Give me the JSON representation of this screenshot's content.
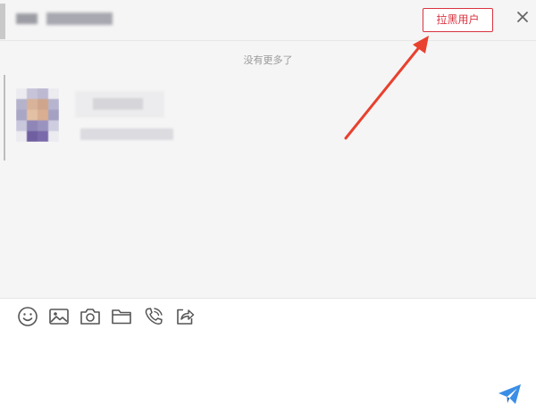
{
  "header": {
    "block_user_label": "拉黑用户",
    "close_icon": "close-icon"
  },
  "messages": {
    "no_more_text": "没有更多了"
  },
  "toolbar": {
    "icons": [
      "emoji-icon",
      "image-icon",
      "camera-icon",
      "folder-icon",
      "phone-call-icon",
      "share-icon"
    ]
  },
  "composer": {
    "input_value": "",
    "send_icon": "send-icon"
  },
  "colors": {
    "accent_red": "#d9333f",
    "send_blue": "#3a8ee6",
    "background": "#f5f5f5",
    "arrow": "#e8412f"
  }
}
